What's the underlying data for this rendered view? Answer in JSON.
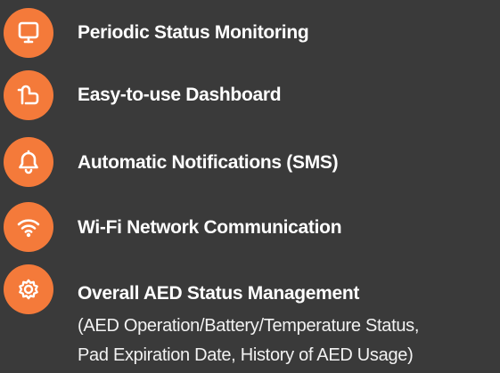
{
  "features": [
    {
      "icon": "monitor-icon",
      "title": "Periodic Status Monitoring"
    },
    {
      "icon": "dashboard-icon",
      "title": "Easy-to-use Dashboard"
    },
    {
      "icon": "bell-icon",
      "title": "Automatic Notifications (SMS)"
    },
    {
      "icon": "wifi-icon",
      "title": "Wi-Fi Network Communication"
    },
    {
      "icon": "gear-icon",
      "title": "Overall AED Status Management",
      "description_lines": [
        "(AED Operation/Battery/Temperature Status,",
        "Pad Expiration Date, History of AED Usage)"
      ]
    }
  ],
  "colors": {
    "background": "#3a3a3a",
    "accent": "#f47a3a",
    "text": "#ffffff"
  }
}
